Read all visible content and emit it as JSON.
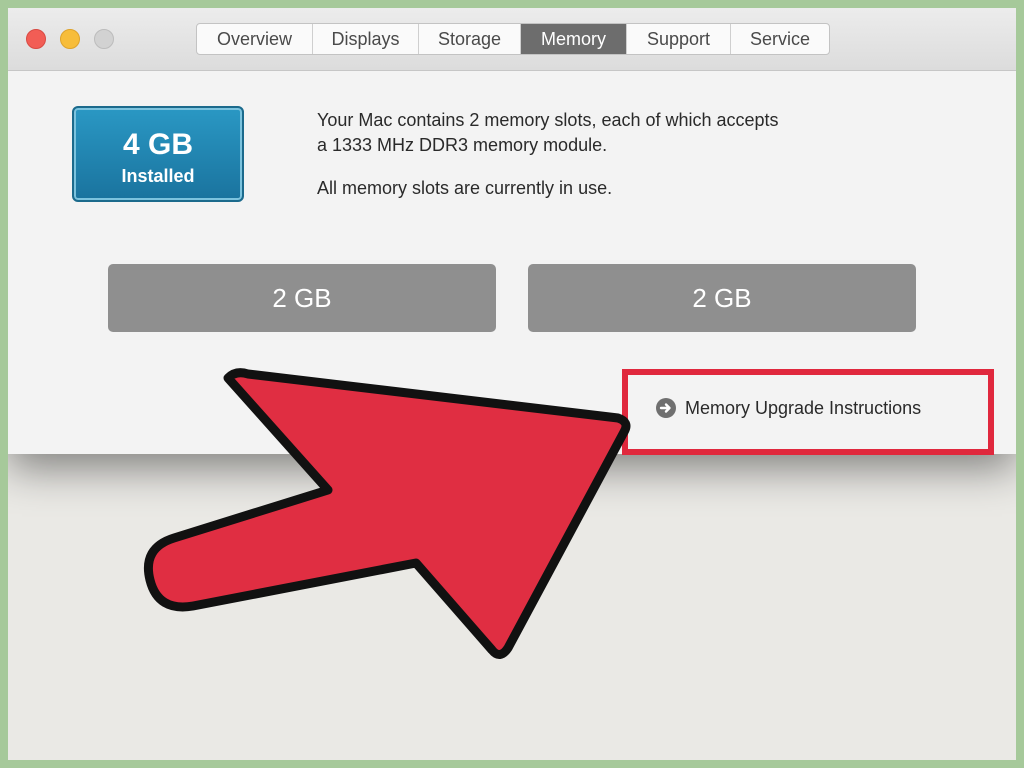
{
  "window": {
    "tabs": [
      {
        "label": "Overview"
      },
      {
        "label": "Displays"
      },
      {
        "label": "Storage"
      },
      {
        "label": "Memory"
      },
      {
        "label": "Support"
      },
      {
        "label": "Service"
      }
    ],
    "active_tab": "Memory"
  },
  "memory": {
    "installed_amount": "4 GB",
    "installed_label": "Installed",
    "description_line1": "Your Mac contains 2 memory slots, each of which accepts",
    "description_line2": "a 1333 MHz DDR3 memory module.",
    "status": "All memory slots are currently in use.",
    "slots": [
      {
        "size": "2 GB"
      },
      {
        "size": "2 GB"
      }
    ],
    "upgrade_link": "Memory Upgrade Instructions"
  },
  "annotations": {
    "highlight_color": "#e0283d",
    "arrow_color": "#e02e42"
  }
}
